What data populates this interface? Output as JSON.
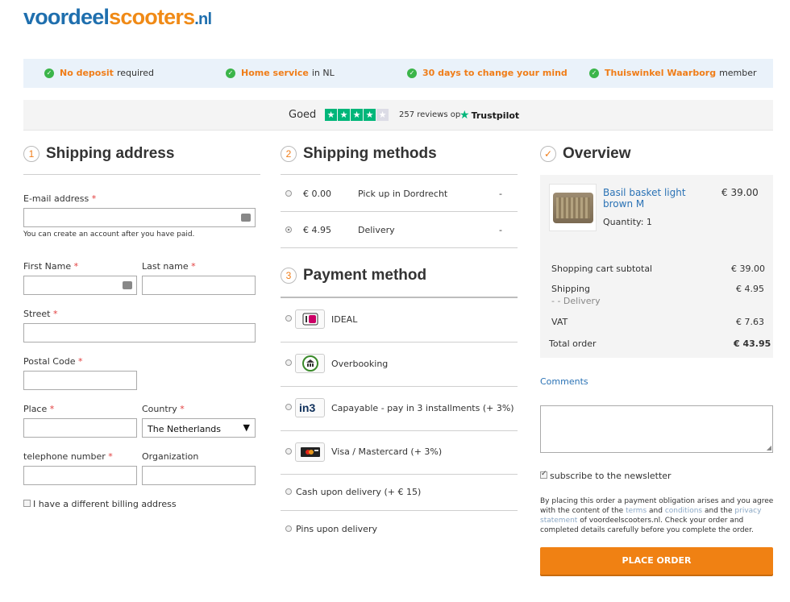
{
  "logo": {
    "part1": "voordeel",
    "part2": "scooters",
    "part3": ".nl"
  },
  "usp": [
    {
      "highlight": "No deposit",
      "rest": "required"
    },
    {
      "highlight": "Home service",
      "rest": "in NL"
    },
    {
      "highlight": "30 days to change your mind",
      "rest": ""
    },
    {
      "highlight": "Thuiswinkel Waarborg",
      "rest": "member"
    }
  ],
  "trust": {
    "rating_word": "Goed",
    "stars_filled": 4,
    "stars_total": 5,
    "reviews": "257 reviews op",
    "brand": "Trustpilot"
  },
  "shipping_address": {
    "number": "1",
    "title": "Shipping address",
    "email_label": "E-mail address",
    "email_hint": "You can create an account after you have paid.",
    "first_name_label": "First Name",
    "last_name_label": "Last name",
    "street_label": "Street",
    "postal_label": "Postal Code",
    "place_label": "Place",
    "country_label": "Country",
    "country_value": "The Netherlands",
    "phone_label": "telephone number",
    "org_label": "Organization",
    "billing_label": "I have a different billing address",
    "required_mark": "*"
  },
  "shipping_methods": {
    "number": "2",
    "title": "Shipping methods",
    "options": [
      {
        "price": "€ 0.00",
        "name": "Pick up in Dordrecht",
        "extra": "-",
        "selected": false
      },
      {
        "price": "€ 4.95",
        "name": "Delivery",
        "extra": "-",
        "selected": true
      }
    ]
  },
  "payment": {
    "number": "3",
    "title": "Payment method",
    "options": [
      {
        "label": "IDEAL",
        "icon": "ideal-icon"
      },
      {
        "label": "Overbooking",
        "icon": "bank-transfer-icon"
      },
      {
        "label": "Capayable - pay in 3 installments (+ 3%)",
        "icon": "in3-icon"
      },
      {
        "label": "Visa / Mastercard (+ 3%)",
        "icon": "credit-card-icon"
      },
      {
        "label": "Cash upon delivery (+ € 15)",
        "icon": ""
      },
      {
        "label": "Pins upon delivery",
        "icon": ""
      }
    ]
  },
  "overview": {
    "title": "Overview",
    "product_name": "Basil basket light brown M",
    "product_price": "€ 39.00",
    "quantity": "Quantity: 1",
    "subtotal_label": "Shopping cart subtotal",
    "subtotal_value": "€ 39.00",
    "shipping_label": "Shipping",
    "shipping_sub": "- - Delivery",
    "shipping_value": "€ 4.95",
    "vat_label": "VAT",
    "vat_value": "€ 7.63",
    "total_label": "Total order",
    "total_value": "€ 43.95"
  },
  "comments_label": "Comments",
  "newsletter_label": "subscribe to the newsletter",
  "legal": {
    "p1": "By placing this order a payment obligation arises and you agree with the content of the ",
    "terms": "terms",
    "and": " and ",
    "conditions": "conditions",
    "p2": " and the ",
    "privacy": "privacy statement",
    "p3": " of voordeelscooters.nl. Check your order and completed details carefully before you complete the order."
  },
  "place_order": "PLACE ORDER",
  "colors": {
    "accent": "#f08113",
    "link": "#2a72b5",
    "check": "#3bb54a",
    "trustpilot": "#00b67a"
  }
}
